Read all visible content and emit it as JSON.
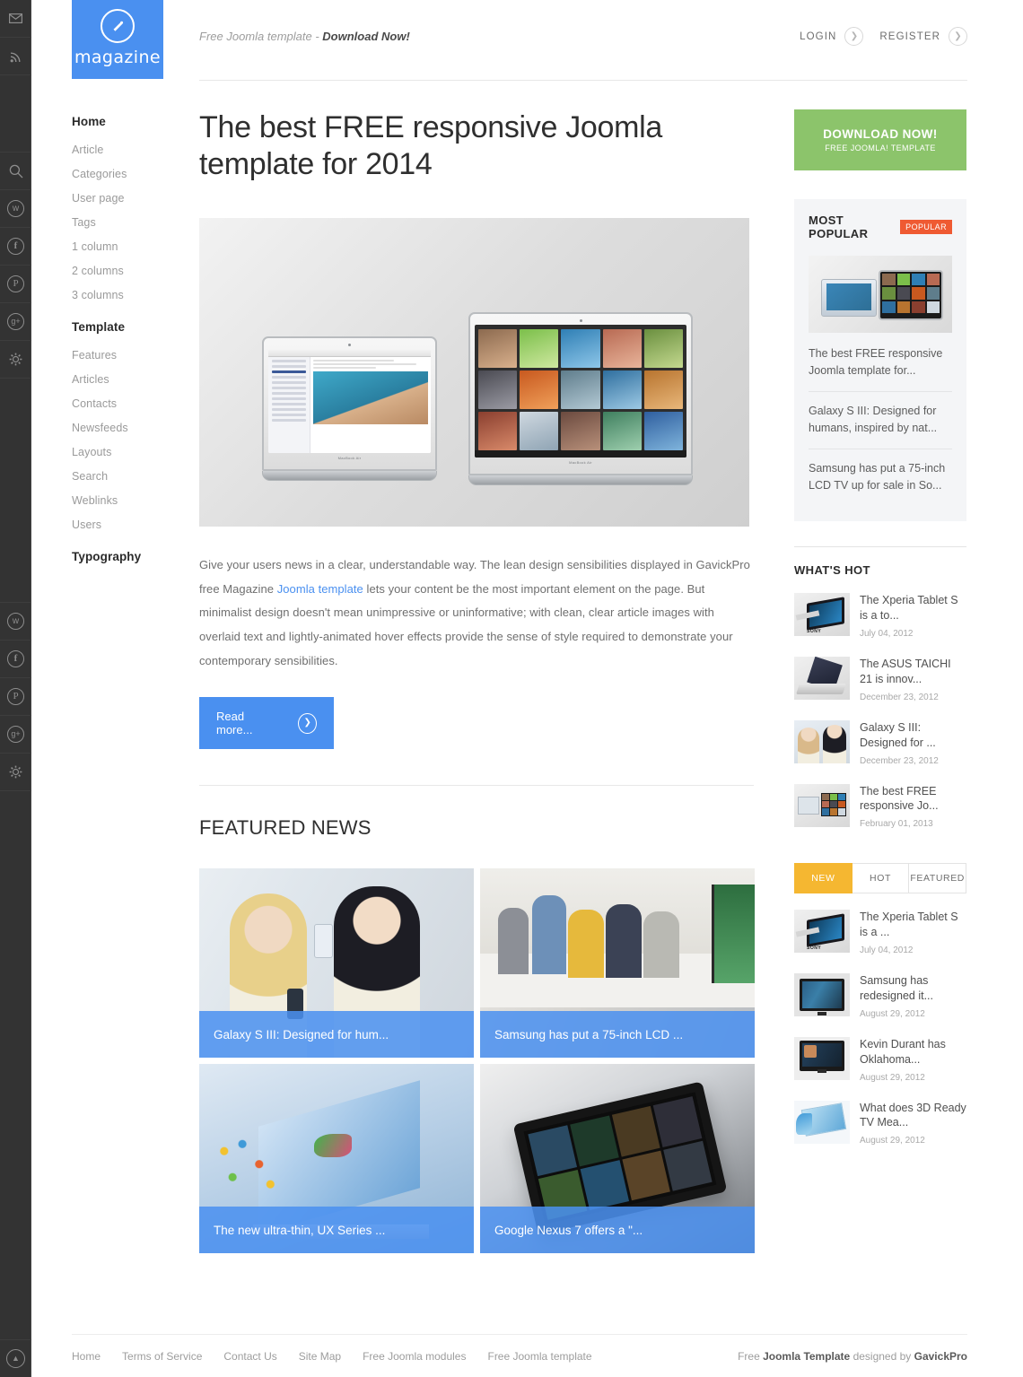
{
  "colors": {
    "brand_blue": "#4a90f0",
    "green": "#8cc46b",
    "orange_badge": "#ef5a32",
    "tab_yellow": "#f5b731",
    "rail_dark": "#333333"
  },
  "rail": {
    "top_icons": [
      "mail-icon",
      "rss-icon"
    ],
    "mid_icons": [
      "search-icon",
      "twitter-icon",
      "facebook-icon",
      "pinterest-icon",
      "googleplus-icon",
      "gear-icon"
    ],
    "bottom_icons": [
      "twitter-icon",
      "facebook-icon",
      "pinterest-icon",
      "googleplus-icon",
      "gear-icon"
    ],
    "scroll_top_icon": "chevron-up-icon"
  },
  "logo": {
    "text": "magazine",
    "mark_icon": "pen-circle-icon"
  },
  "header": {
    "tagline_prefix": "Free Joomla template - ",
    "tagline_strong": "Download Now!",
    "login_label": "LOGIN",
    "register_label": "REGISTER"
  },
  "sidebar": {
    "blocks": [
      {
        "head": "Home",
        "items": [
          "Article",
          "Categories",
          "User page",
          "Tags",
          "1 column",
          "2 columns",
          "3 columns"
        ]
      },
      {
        "head": "Template",
        "items": [
          "Features",
          "Articles",
          "Contacts",
          "Newsfeeds",
          "Layouts",
          "Search",
          "Weblinks",
          "Users"
        ]
      },
      {
        "head": "Typography",
        "items": []
      }
    ]
  },
  "article": {
    "title": "The best FREE responsive Joomla template for 2014",
    "hero_alt": "two-macbook-air-laptops",
    "lead_p1": "Give your users news in a clear, understandable way. The lean design sensibilities displayed in GavickPro free Magazine ",
    "lead_link": "Joomla template",
    "lead_p2": " lets your content be the most important element on the page. But minimalist design doesn't mean unimpressive or uninformative; with clean, clear article images with overlaid text and lightly-animated hover effects provide the sense of style required to demonstrate your contemporary sensibilities.",
    "read_more": "Read more..."
  },
  "featured": {
    "title": "FEATURED NEWS",
    "cards": [
      {
        "caption": "Galaxy S III: Designed for hum...",
        "image": "two-women-with-galaxy-phones"
      },
      {
        "caption": "Samsung has put a 75-inch LCD ...",
        "image": "people-watching-tv-in-livingroom"
      },
      {
        "caption": "The new ultra-thin, UX Series ...",
        "image": "laptop-with-hummingbird"
      },
      {
        "caption": "Google Nexus 7 offers a \"...",
        "image": "black-tablet-on-white"
      }
    ]
  },
  "download_button": {
    "line1": "DOWNLOAD NOW!",
    "line2": "FREE JOOMLA! TEMPLATE"
  },
  "most_popular": {
    "title": "MOST POPULAR",
    "badge": "POPULAR",
    "lead_thumb": "two-laptops-thumbnail",
    "items": [
      "The best FREE responsive Joomla template for...",
      "Galaxy S III: Designed for humans, inspired by nat...",
      "Samsung has put a 75-inch LCD TV up for sale in So..."
    ]
  },
  "whats_hot": {
    "title": "WHAT'S HOT",
    "items": [
      {
        "title": "The Xperia Tablet S is a to...",
        "date": "July 04, 2012",
        "image": "sony-xperia-tablet"
      },
      {
        "title": "The ASUS TAICHI 21 is innov...",
        "date": "December 23, 2012",
        "image": "asus-taichi-laptop"
      },
      {
        "title": "Galaxy S III: Designed for ...",
        "date": "December 23, 2012",
        "image": "two-women-with-phones"
      },
      {
        "title": "The best FREE responsive Jo...",
        "date": "February 01, 2013",
        "image": "two-laptops"
      }
    ]
  },
  "tabs_module": {
    "tabs": [
      "NEW",
      "HOT",
      "FEATURED"
    ],
    "active": "NEW",
    "items": [
      {
        "title": "The Xperia Tablet S is a ...",
        "date": "July 04, 2012",
        "image": "sony-xperia-tablet"
      },
      {
        "title": "Samsung has redesigned it...",
        "date": "August 29, 2012",
        "image": "samsung-smart-tv"
      },
      {
        "title": "Kevin Durant has Oklahoma...",
        "date": "August 29, 2012",
        "image": "tv-with-player"
      },
      {
        "title": "What does 3D Ready TV Mea...",
        "date": "August 29, 2012",
        "image": "3d-tv-splash"
      }
    ]
  },
  "footer": {
    "links": [
      "Home",
      "Terms of Service",
      "Contact Us",
      "Site Map",
      "Free Joomla modules",
      "Free Joomla template"
    ],
    "credit_pre": "Free ",
    "credit_b1": "Joomla Template",
    "credit_mid": " designed by ",
    "credit_b2": "GavickPro"
  }
}
